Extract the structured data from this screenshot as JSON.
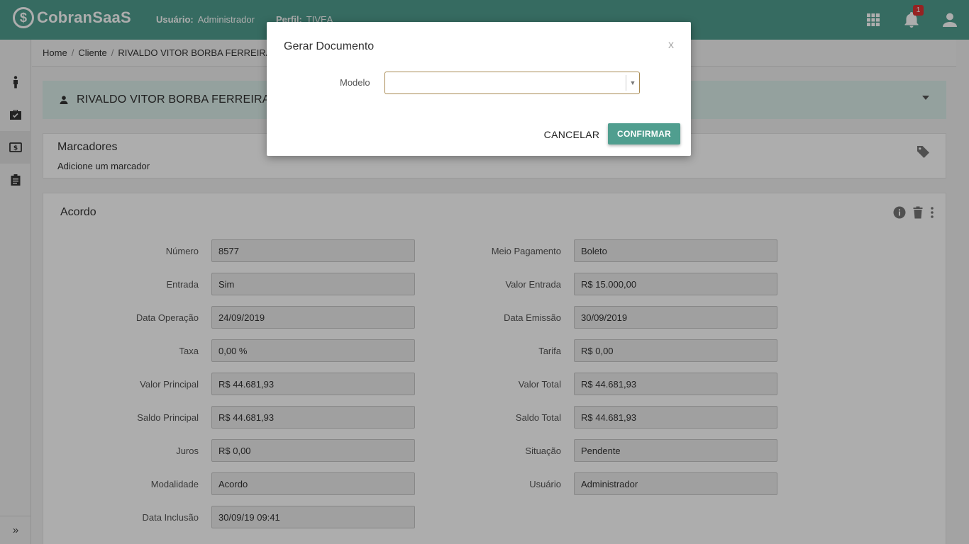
{
  "app": {
    "logo_mark": "$",
    "logo_text": "CobranSaaS",
    "user_label": "Usuário:",
    "user_value": "Administrador",
    "profile_label": "Perfil:",
    "profile_value": "TIVEA",
    "notification_count": "1",
    "accent_color": "#509e8f"
  },
  "topbar_icons": [
    "apps-grid-icon",
    "bell-icon",
    "account-icon"
  ],
  "sidebar": {
    "items": [
      "person-icon",
      "briefcase-icon",
      "money-icon",
      "clipboard-icon"
    ],
    "expand_label": "»"
  },
  "breadcrumb": [
    "Home",
    "Cliente",
    "RIVALDO VITOR BORBA FERREIRA"
  ],
  "client": {
    "name": "RIVALDO VITOR BORBA FERREIRA"
  },
  "marcadores": {
    "title": "Marcadores",
    "subtitle": "Adicione um marcador"
  },
  "acordo": {
    "title": "Acordo",
    "left_fields": [
      {
        "label": "Número",
        "value": "8577"
      },
      {
        "label": "Entrada",
        "value": "Sim"
      },
      {
        "label": "Data Operação",
        "value": "24/09/2019"
      },
      {
        "label": "Taxa",
        "value": "0,00 %"
      },
      {
        "label": "Valor Principal",
        "value": "R$ 44.681,93"
      },
      {
        "label": "Saldo Principal",
        "value": "R$ 44.681,93"
      },
      {
        "label": "Juros",
        "value": "R$ 0,00"
      },
      {
        "label": "Modalidade",
        "value": "Acordo"
      },
      {
        "label": "Data Inclusão",
        "value": "30/09/19 09:41"
      }
    ],
    "right_fields": [
      {
        "label": "Meio Pagamento",
        "value": "Boleto"
      },
      {
        "label": "Valor Entrada",
        "value": "R$ 15.000,00"
      },
      {
        "label": "Data Emissão",
        "value": "30/09/2019"
      },
      {
        "label": "Tarifa",
        "value": "R$ 0,00"
      },
      {
        "label": "Valor Total",
        "value": "R$ 44.681,93"
      },
      {
        "label": "Saldo Total",
        "value": "R$ 44.681,93"
      },
      {
        "label": "Situação",
        "value": "Pendente"
      },
      {
        "label": "Usuário",
        "value": "Administrador"
      }
    ]
  },
  "modal": {
    "title": "Gerar Documento",
    "close_label": "x",
    "field_label": "Modelo",
    "field_value": "",
    "cancel_label": "CANCELAR",
    "confirm_label": "CONFIRMAR"
  }
}
